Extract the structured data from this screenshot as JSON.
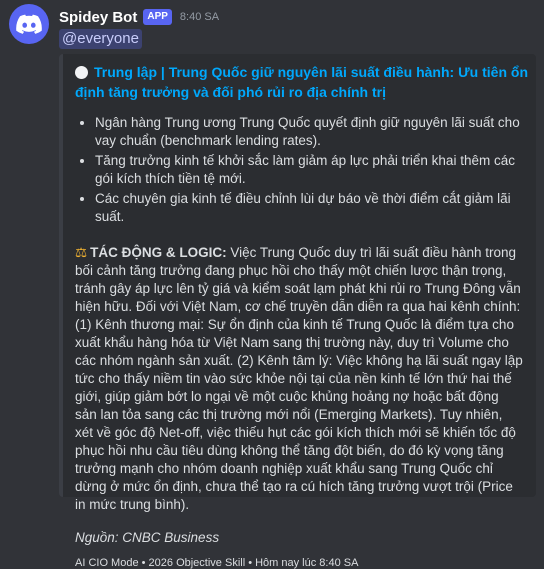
{
  "message": {
    "username": "Spidey Bot",
    "badge": "APP",
    "timestamp": "8:40 SA",
    "mention": "@everyone"
  },
  "embed": {
    "title_line1": "Trung lập | Trung Quốc giữ nguyên lãi suất điều hành: Ưu tiên ổn",
    "title_line2": "định tăng trưởng và đối phó rủi ro địa chính trị",
    "bullets": [
      "Ngân hàng Trung ương Trung Quốc quyết định giữ nguyên lãi suất cho vay chuẩn (benchmark lending rates).",
      "Tăng trưởng kinh tế khởi sắc làm giảm áp lực phải triển khai thêm các gói kích thích tiền tệ mới.",
      "Các chuyên gia kinh tế điều chỉnh lùi dự báo về thời điểm cắt giảm lãi suất."
    ],
    "impact_label": "TÁC ĐỘNG & LOGIC:",
    "impact_text": "Việc Trung Quốc duy trì lãi suất điều hành trong bối cảnh tăng trưởng đang phục hồi cho thấy một chiến lược thận trọng, tránh gây áp lực lên tỷ giá và kiểm soát lạm phát khi rủi ro Trung Đông vẫn hiện hữu. Đối với Việt Nam, cơ chế truyền dẫn diễn ra qua hai kênh chính: (1) Kênh thương mại: Sự ổn định của kinh tế Trung Quốc là điểm tựa cho xuất khẩu hàng hóa từ Việt Nam sang thị trường này, duy trì Volume cho các nhóm ngành sản xuất. (2) Kênh tâm lý: Việc không hạ lãi suất ngay lập tức cho thấy niềm tin vào sức khỏe nội tại của nền kinh tế lớn thứ hai thế giới, giúp giảm bớt lo ngại về một cuộc khủng hoảng nợ hoặc bất động sản lan tỏa sang các thị trường mới nổi (Emerging Markets). Tuy nhiên, xét về góc độ Net-off, việc thiếu hụt các gói kích thích mới sẽ khiến tốc độ phục hồi nhu cầu tiêu dùng không thể tăng đột biến, do đó kỳ vọng tăng trưởng mạnh cho nhóm doanh nghiệp xuất khẩu sang Trung Quốc chỉ dừng ở mức ổn định, chưa thể tạo ra cú hích tăng trưởng vượt trội (Price in mức trung bình).",
    "source": "Nguồn: CNBC Business",
    "footer": "AI CIO Mode • 2026 Objective Skill • Hôm nay lúc 8:40 SA"
  },
  "colors": {
    "background": "#313338",
    "embed_bg": "#2b2d31",
    "title_link": "#00a8fc",
    "brand": "#5865f2"
  },
  "icons": {
    "avatar": "discord-logo-icon",
    "title": "white-circle-icon",
    "impact": "balance-scale-icon"
  }
}
